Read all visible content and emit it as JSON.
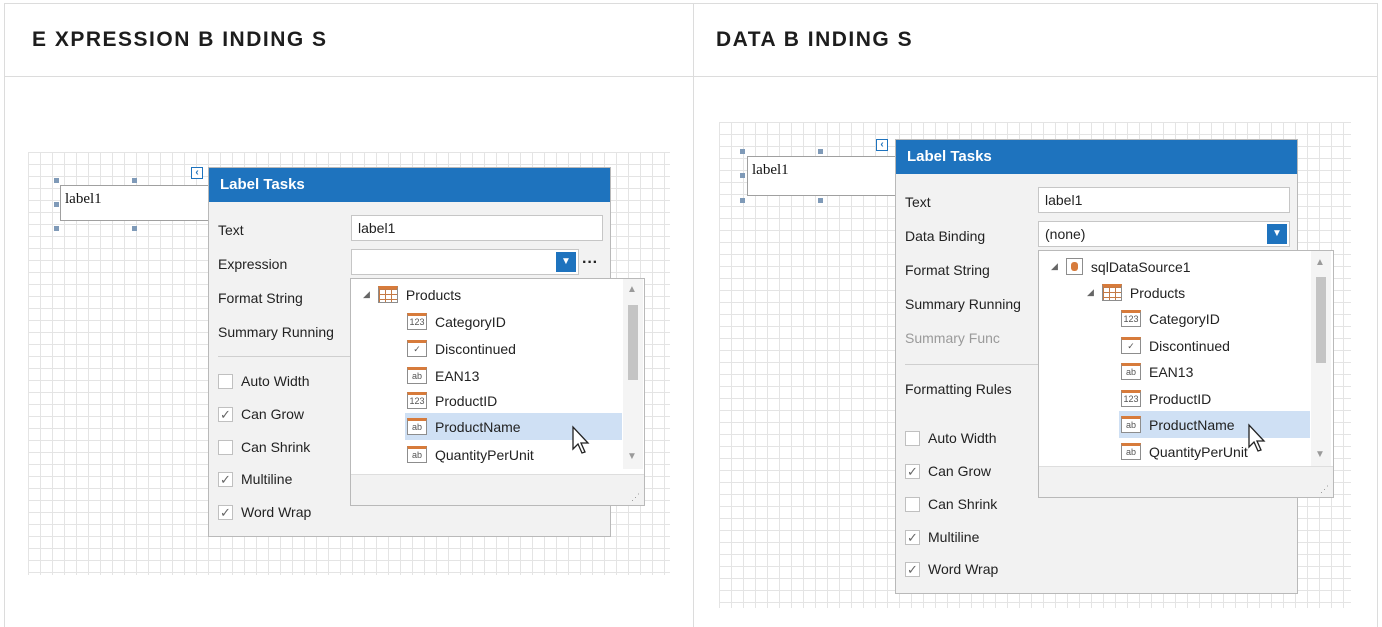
{
  "headers": {
    "left": "E XPRESSION B INDING S",
    "right": "DATA B INDING S"
  },
  "left": {
    "designer_label": "label1",
    "panel_title": "Label Tasks",
    "text_label": "Text",
    "text_value": "label1",
    "expression_label": "Expression",
    "expression_value": "",
    "format_string_label": "Format String",
    "summary_running_label": "Summary Running",
    "checkboxes": [
      {
        "label": "Auto Width",
        "checked": false
      },
      {
        "label": "Can Grow",
        "checked": true
      },
      {
        "label": "Can Shrink",
        "checked": false
      },
      {
        "label": "Multiline",
        "checked": true
      },
      {
        "label": "Word Wrap",
        "checked": true
      }
    ],
    "tree_root": "Products",
    "fields": [
      {
        "label": "CategoryID",
        "icon": "number-icon",
        "glyph": "123"
      },
      {
        "label": "Discontinued",
        "icon": "boolean-icon",
        "glyph": "✓"
      },
      {
        "label": "EAN13",
        "icon": "string-icon",
        "glyph": "ab"
      },
      {
        "label": "ProductID",
        "icon": "number-icon",
        "glyph": "123"
      },
      {
        "label": "ProductName",
        "icon": "string-icon",
        "glyph": "ab",
        "selected": true
      },
      {
        "label": "QuantityPerUnit",
        "icon": "string-icon",
        "glyph": "ab"
      }
    ]
  },
  "right": {
    "designer_label": "label1",
    "panel_title": "Label Tasks",
    "text_label": "Text",
    "text_value": "label1",
    "data_binding_label": "Data Binding",
    "data_binding_value": "(none)",
    "format_string_label": "Format String",
    "summary_running_label": "Summary Running",
    "summary_func_label": "Summary Func",
    "formatting_rules_label": "Formatting Rules",
    "checkboxes": [
      {
        "label": "Auto Width",
        "checked": false
      },
      {
        "label": "Can Grow",
        "checked": true
      },
      {
        "label": "Can Shrink",
        "checked": false
      },
      {
        "label": "Multiline",
        "checked": true
      },
      {
        "label": "Word Wrap",
        "checked": true
      }
    ],
    "datasource": "sqlDataSource1",
    "tree_root": "Products",
    "fields": [
      {
        "label": "CategoryID",
        "icon": "number-icon",
        "glyph": "123"
      },
      {
        "label": "Discontinued",
        "icon": "boolean-icon",
        "glyph": "✓"
      },
      {
        "label": "EAN13",
        "icon": "string-icon",
        "glyph": "ab"
      },
      {
        "label": "ProductID",
        "icon": "number-icon",
        "glyph": "123"
      },
      {
        "label": "ProductName",
        "icon": "string-icon",
        "glyph": "ab",
        "selected": true
      },
      {
        "label": "QuantityPerUnit",
        "icon": "string-icon",
        "glyph": "ab"
      }
    ]
  },
  "colors": {
    "accent": "#1e73be",
    "selection": "#cfe0f4",
    "field_icon": "#d77b3b"
  },
  "icons": {
    "smart_tag": "smart-tag-icon",
    "dropdown": "chevron-down-icon",
    "expand": "collapse-arrow-icon",
    "cursor": "mouse-pointer-icon"
  }
}
